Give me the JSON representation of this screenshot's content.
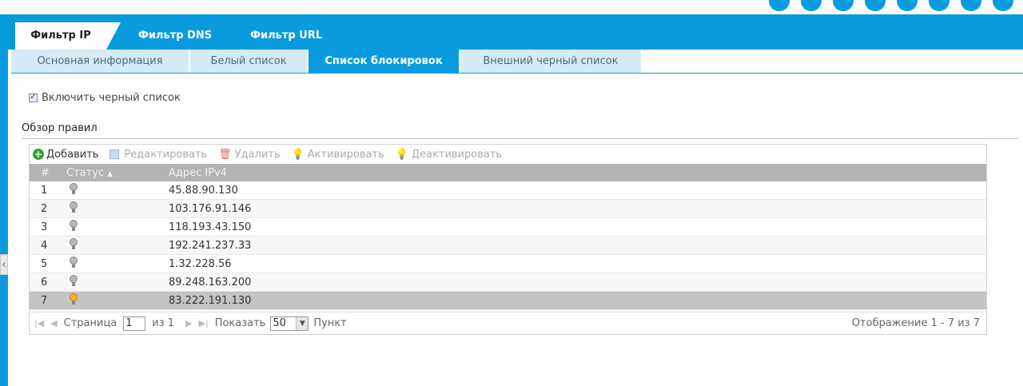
{
  "main_tabs": [
    {
      "label": "Фильтр IP",
      "active": true
    },
    {
      "label": "Фильтр DNS",
      "active": false
    },
    {
      "label": "Фильтр URL",
      "active": false
    }
  ],
  "sub_tabs": [
    {
      "label": "Основная информация",
      "active": false
    },
    {
      "label": "Белый список",
      "active": false
    },
    {
      "label": "Список блокировок",
      "active": true
    },
    {
      "label": "Внешний черный список",
      "active": false
    }
  ],
  "blacklist": {
    "label": "Включить черный список",
    "checked": true
  },
  "section_title": "Обзор правил",
  "toolbar": {
    "add": "Добавить",
    "edit": "Редактировать",
    "delete": "Удалить",
    "activate": "Активировать",
    "deactivate": "Деактивировать"
  },
  "table": {
    "columns": {
      "num": "#",
      "status": "Статус",
      "sort_arrow": "▲",
      "address": "Адрес IPv4"
    },
    "rows": [
      {
        "num": "1",
        "address": "45.88.90.130",
        "active": false
      },
      {
        "num": "2",
        "address": "103.176.91.146",
        "active": false
      },
      {
        "num": "3",
        "address": "118.193.43.150",
        "active": false
      },
      {
        "num": "4",
        "address": "192.241.237.33",
        "active": false
      },
      {
        "num": "5",
        "address": "1.32.228.56",
        "active": false
      },
      {
        "num": "6",
        "address": "89.248.163.200",
        "active": false
      },
      {
        "num": "7",
        "address": "83.222.191.130",
        "active": true
      }
    ]
  },
  "pager": {
    "page_label": "Страница",
    "page_value": "1",
    "of_label": "из 1",
    "show_label": "Показать",
    "page_size": "50",
    "items_label": "Пункт",
    "display_info": "Отображение 1 - 7 из 7"
  },
  "colors": {
    "accent": "#0a9bde",
    "header_row": "#b3b3b3",
    "selected_row": "#c4c4c4"
  }
}
